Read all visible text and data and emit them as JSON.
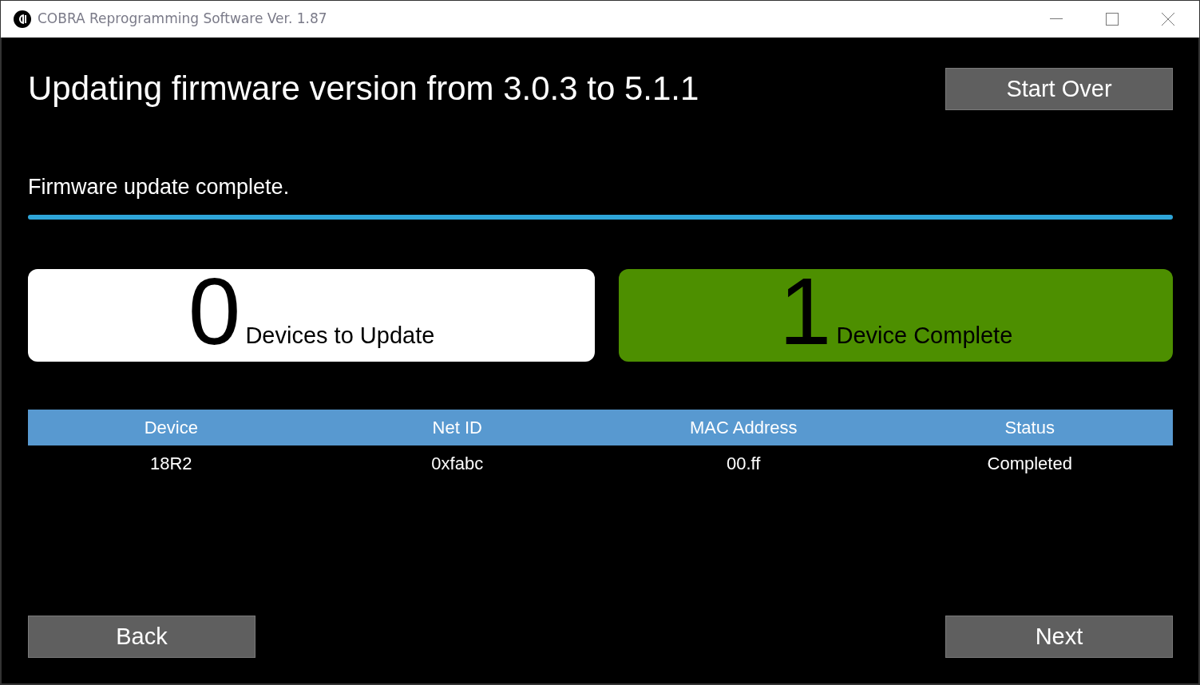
{
  "window": {
    "title": "COBRA Reprogramming Software Ver. 1.87"
  },
  "heading": "Updating firmware version from 3.0.3 to 5.1.1",
  "start_over_button": "Start Over",
  "status": {
    "text": "Firmware update complete.",
    "level": 1
  },
  "counters": [
    {
      "kind": "pending",
      "count": "0",
      "label": "Devices to Update"
    },
    {
      "kind": "complete",
      "count": "1",
      "label": "Device Complete"
    }
  ],
  "table": {
    "columns": [
      "Device",
      "Net ID",
      "MAC Address",
      "Status"
    ],
    "rows": [
      [
        "18R2",
        "0xfabc",
        "00.ff",
        "Completed"
      ]
    ]
  },
  "buttons": {
    "back": "Back",
    "next": "Next"
  }
}
